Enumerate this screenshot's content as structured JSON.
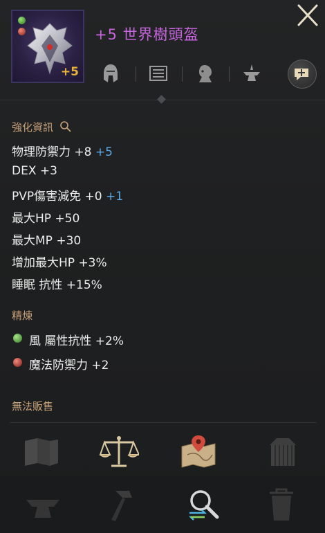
{
  "item": {
    "enhance_badge": "+5",
    "title": "+5 世界樹頭盔"
  },
  "tabs": [
    {
      "icon": "helmet-icon"
    },
    {
      "icon": "book-icon"
    },
    {
      "icon": "bust-icon"
    },
    {
      "icon": "anvil-icon"
    },
    {
      "icon": "chat-bubble-plus-icon"
    }
  ],
  "enhance_info": {
    "label": "強化資訊",
    "stats": [
      {
        "text": "物理防禦力 +8",
        "bonus": "+5"
      },
      {
        "text": "DEX +3",
        "bonus": ""
      },
      {
        "text": "PVP傷害減免 +0",
        "bonus": "+1"
      },
      {
        "text": "最大HP +50",
        "bonus": ""
      },
      {
        "text": "最大MP +30",
        "bonus": ""
      },
      {
        "text": "增加最大HP +3%",
        "bonus": ""
      },
      {
        "text": "睡眠 抗性 +15%",
        "bonus": ""
      }
    ]
  },
  "refine": {
    "label": "精煉",
    "stats": [
      {
        "text": "風 屬性抗性 +2%",
        "gem": "green"
      },
      {
        "text": "魔法防禦力 +2",
        "gem": "red"
      }
    ]
  },
  "sale_status": "無法販售",
  "colors": {
    "title": "#c964e0",
    "bonus": "#5aa9e8",
    "section_label": "#c8a27a",
    "enhance_badge": "#e8b23a"
  }
}
